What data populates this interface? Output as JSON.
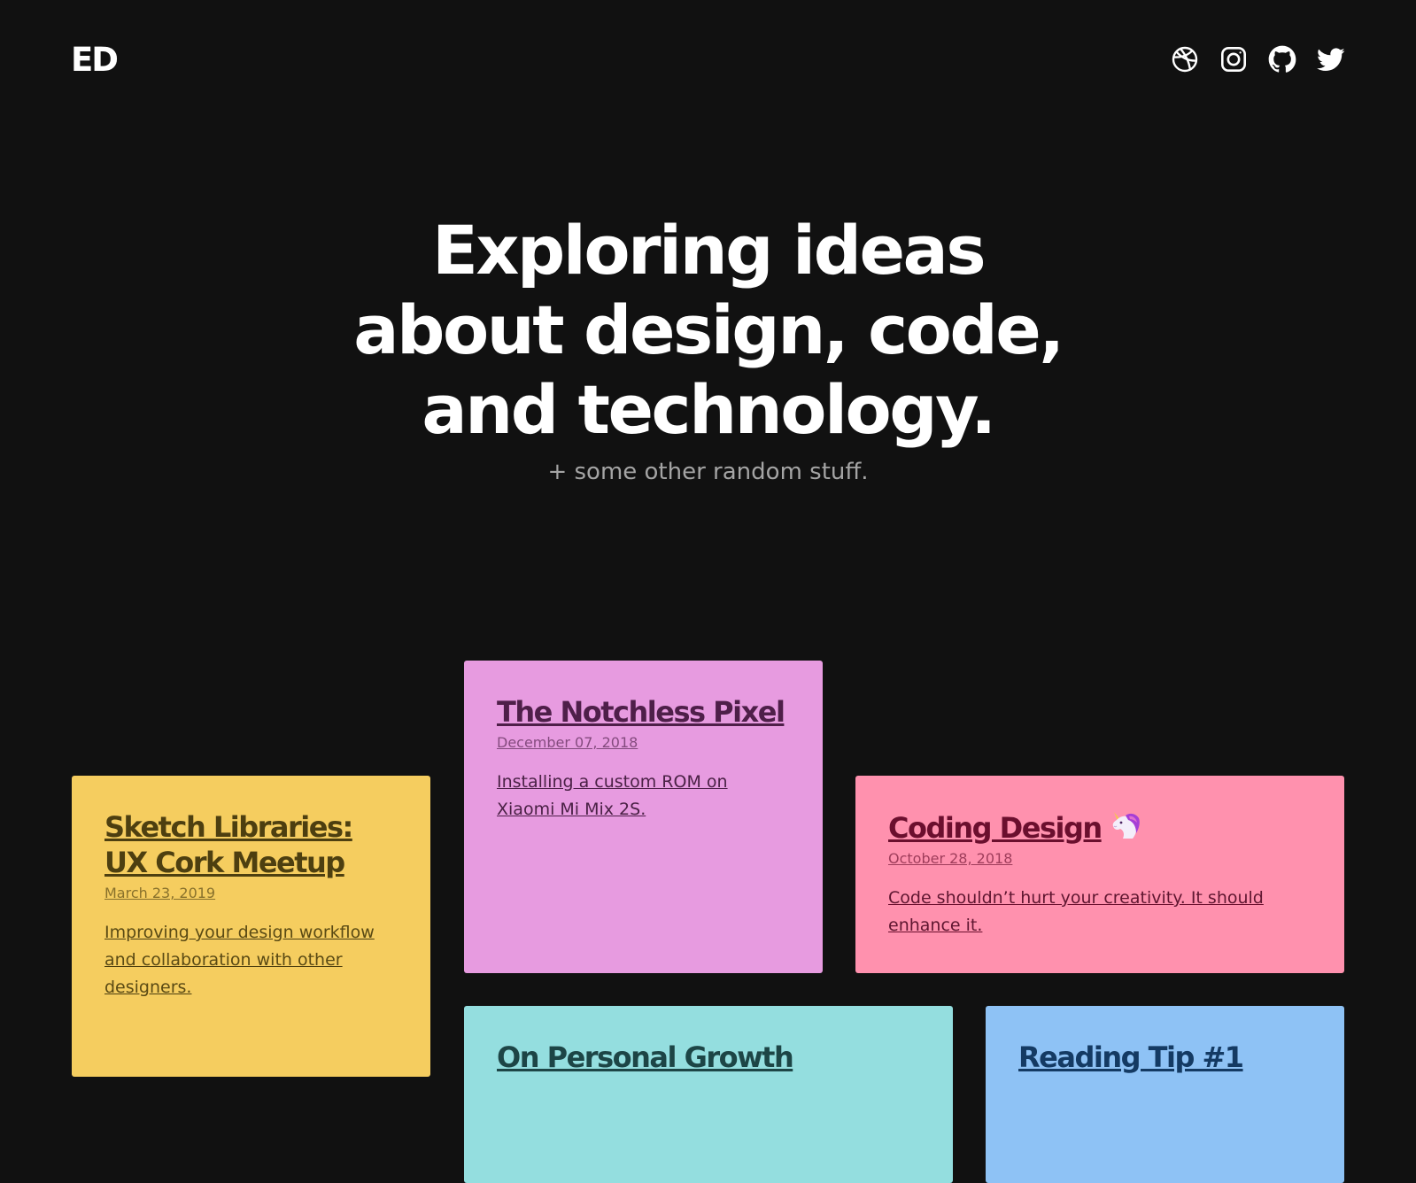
{
  "header": {
    "logo": "ED",
    "social": [
      {
        "name": "dribbble",
        "icon": "dribbble-icon"
      },
      {
        "name": "instagram",
        "icon": "instagram-icon"
      },
      {
        "name": "github",
        "icon": "github-icon"
      },
      {
        "name": "twitter",
        "icon": "twitter-icon"
      }
    ]
  },
  "hero": {
    "title_lines": [
      "Exploring ideas",
      "about design, code,",
      "and technology."
    ],
    "subtitle": "+ some other random stuff."
  },
  "posts": [
    {
      "title": "Sketch Libraries: UX Cork Meetup",
      "date": "March 23, 2019",
      "description": "Improving your design workflow and collaboration with other designers.",
      "color": "#f5cd5f"
    },
    {
      "title": "The Notchless Pixel",
      "date": "December 07, 2018",
      "description": "Installing a custom ROM on Xiaomi Mi Mix 2S.",
      "color": "#e79be0"
    },
    {
      "title": "Coding Design",
      "title_emoji": "unicorn-icon",
      "date": "October 28, 2018",
      "description": "Code shouldn’t hurt your creativity. It should enhance it.",
      "color": "#ff91ae"
    },
    {
      "title": "On Personal Growth",
      "color": "#94dedf"
    },
    {
      "title": "Reading Tip #1",
      "color": "#8ec2f5"
    }
  ],
  "colors": {
    "background": "#111111",
    "text": "#ffffff",
    "subtitle": "#a4a4a4"
  }
}
